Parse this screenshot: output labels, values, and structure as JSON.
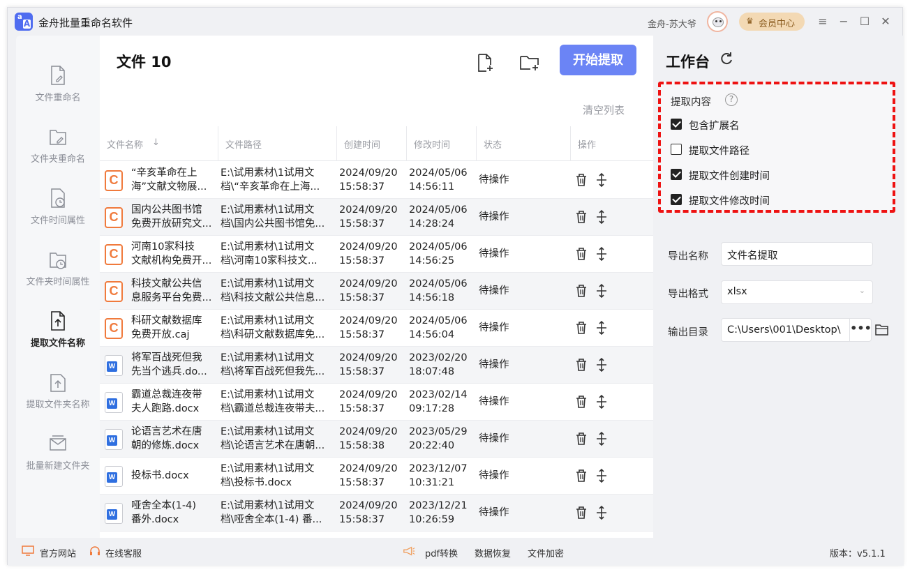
{
  "app": {
    "title": "金舟批量重命名软件",
    "user_name": "金舟-苏大爷",
    "vip_label": "会员中心"
  },
  "nav": [
    {
      "label": "文件重命名",
      "icon": "file-edit-icon",
      "active": false
    },
    {
      "label": "文件夹重命名",
      "icon": "folder-edit-icon",
      "active": false
    },
    {
      "label": "文件时间属性",
      "icon": "file-clock-icon",
      "active": false
    },
    {
      "label": "文件夹时间属性",
      "icon": "folder-clock-icon",
      "active": false
    },
    {
      "label": "提取文件名称",
      "icon": "file-upload-icon",
      "active": true
    },
    {
      "label": "提取文件夹名称",
      "icon": "folder-upload-icon",
      "active": false
    },
    {
      "label": "批量新建文件夹",
      "icon": "mail-folder-icon",
      "active": false
    }
  ],
  "main": {
    "file_count": "文件 10",
    "start_button": "开始提取",
    "clear_list": "清空列表",
    "columns": [
      "文件名称",
      "文件路径",
      "创建时间",
      "修改时间",
      "状态",
      "操作"
    ]
  },
  "rows": [
    {
      "type": "caj",
      "name1": "“辛亥革命在上",
      "name2": "海”文献文物展...",
      "path1": "E:\\试用素材\\1试用文",
      "path2": "档\\“辛亥革命在上海...",
      "cdate": "2024/09/20",
      "ctime": "15:58:37",
      "mdate": "2024/05/06",
      "mtime": "14:56:11",
      "status": "待操作"
    },
    {
      "type": "caj",
      "name1": "国内公共图书馆",
      "name2": "免费开放研究文...",
      "path1": "E:\\试用素材\\1试用文",
      "path2": "档\\国内公共图书馆免...",
      "cdate": "2024/09/20",
      "ctime": "15:58:37",
      "mdate": "2024/05/06",
      "mtime": "14:28:24",
      "status": "待操作"
    },
    {
      "type": "caj",
      "name1": "河南10家科技",
      "name2": "文献机构免费开...",
      "path1": "E:\\试用素材\\1试用文",
      "path2": "档\\河南10家科技文...",
      "cdate": "2024/09/20",
      "ctime": "15:58:37",
      "mdate": "2024/05/06",
      "mtime": "14:56:25",
      "status": "待操作"
    },
    {
      "type": "caj",
      "name1": "科技文献公共信",
      "name2": "息服务平台免费...",
      "path1": "E:\\试用素材\\1试用文",
      "path2": "档\\科技文献公共信息...",
      "cdate": "2024/09/20",
      "ctime": "15:58:37",
      "mdate": "2024/05/06",
      "mtime": "14:56:18",
      "status": "待操作"
    },
    {
      "type": "caj",
      "name1": "科研文献数据库",
      "name2": "免费开放.caj",
      "path1": "E:\\试用素材\\1试用文",
      "path2": "档\\科研文献数据库免...",
      "cdate": "2024/09/20",
      "ctime": "15:58:37",
      "mdate": "2024/05/06",
      "mtime": "14:56:04",
      "status": "待操作"
    },
    {
      "type": "docx",
      "name1": "将军百战死但我",
      "name2": "先当个逃兵.do...",
      "path1": "E:\\试用素材\\1试用文",
      "path2": "档\\将军百战死但我先...",
      "cdate": "2024/09/20",
      "ctime": "15:58:37",
      "mdate": "2023/02/20",
      "mtime": "18:07:48",
      "status": "待操作"
    },
    {
      "type": "docx",
      "name1": "霸道总裁连夜带",
      "name2": "夫人跑路.docx",
      "path1": "E:\\试用素材\\1试用文",
      "path2": "档\\霸道总裁连夜带夫...",
      "cdate": "2024/09/20",
      "ctime": "15:58:37",
      "mdate": "2023/02/14",
      "mtime": "09:17:28",
      "status": "待操作"
    },
    {
      "type": "docx",
      "name1": "论语言艺术在唐",
      "name2": "朝的修炼.docx",
      "path1": "E:\\试用素材\\1试用文",
      "path2": "档\\论语言艺术在唐朝...",
      "cdate": "2024/09/20",
      "ctime": "15:58:38",
      "mdate": "2023/05/29",
      "mtime": "20:22:40",
      "status": "待操作"
    },
    {
      "type": "docx",
      "name1": "投标书.docx",
      "name2": "",
      "path1": "E:\\试用素材\\1试用文",
      "path2": "档\\投标书.docx",
      "cdate": "2024/09/20",
      "ctime": "15:58:37",
      "mdate": "2023/12/07",
      "mtime": "10:31:21",
      "status": "待操作"
    },
    {
      "type": "docx",
      "name1": "哑舍全本(1-4)",
      "name2": "番外.docx",
      "path1": "E:\\试用素材\\1试用文",
      "path2": "档\\哑舍全本(1-4) 番...",
      "cdate": "2024/09/20",
      "ctime": "15:58:37",
      "mdate": "2023/12/21",
      "mtime": "10:26:59",
      "status": "待操作"
    }
  ],
  "workbench": {
    "title": "工作台",
    "extract_label": "提取内容",
    "options": [
      {
        "label": "包含扩展名",
        "checked": true
      },
      {
        "label": "提取文件路径",
        "checked": false
      },
      {
        "label": "提取文件创建时间",
        "checked": true
      },
      {
        "label": "提取文件修改时间",
        "checked": true
      }
    ],
    "export_name_label": "导出名称",
    "export_name_value": "文件名提取",
    "export_format_label": "导出格式",
    "export_format_value": "xlsx",
    "output_dir_label": "输出目录",
    "output_dir_value": "C:\\Users\\001\\Desktop\\",
    "more_label": "•••"
  },
  "footer": {
    "website": "官方网站",
    "service": "在线客服",
    "pdf": "pdf转换",
    "recovery": "数据恢复",
    "encrypt": "文件加密",
    "version": "版本：v5.1.1"
  },
  "colors": {
    "accent": "#6b84f5",
    "highlight_border": "#ee1212",
    "caj": "#f07a3c",
    "docx": "#2f6fe0"
  }
}
